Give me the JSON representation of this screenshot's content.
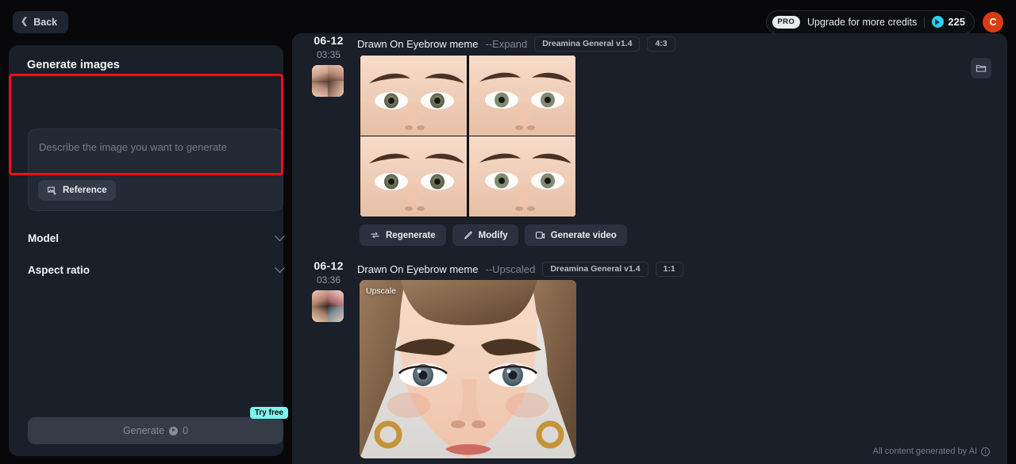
{
  "topbar": {
    "back_label": "Back",
    "back_icon": "chevron-left-icon",
    "pro_badge": "PRO",
    "upgrade_label": "Upgrade for more credits",
    "credit_icon": "credit-coin-icon",
    "credit_count": "225",
    "avatar_initial": "C",
    "avatar_color": "#d93c12",
    "credit_color": "#2fd0ee"
  },
  "left_panel": {
    "title": "Generate images",
    "prompt": {
      "value": "",
      "placeholder": "Describe the image you want to generate",
      "highlight_color": "#ff0a16",
      "reference_label": "Reference",
      "reference_icon": "add-image-icon"
    },
    "sections": [
      {
        "label": "Model",
        "icon": "chevron-down-icon"
      },
      {
        "label": "Aspect ratio",
        "icon": "chevron-down-icon"
      }
    ],
    "generate": {
      "label": "Generate",
      "cost_icon": "credit-coin-icon",
      "cost": "0",
      "try_free_label": "Try free",
      "try_free_color": "#7ef4ec"
    }
  },
  "content": {
    "folder_icon": "folder-icon",
    "footer_note": "All content generated by AI",
    "footer_icon": "info-icon",
    "items": [
      {
        "date": "06-12",
        "time": "03:35",
        "title": "Drawn On Eyebrow meme",
        "suffix": "--Expand",
        "model": "Dreamina General v1.4",
        "ratio": "4:3",
        "badge": "",
        "thumb_name": "generation-thumbnail",
        "actions": [
          {
            "label": "Regenerate",
            "icon": "regenerate-icon"
          },
          {
            "label": "Modify",
            "icon": "pencil-icon"
          },
          {
            "label": "Generate video",
            "icon": "video-icon"
          }
        ]
      },
      {
        "date": "06-12",
        "time": "03:36",
        "title": "Drawn On Eyebrow meme",
        "suffix": "--Upscaled",
        "model": "Dreamina General v1.4",
        "ratio": "1:1",
        "badge": "Upscale",
        "thumb_name": "generation-thumbnail",
        "actions": []
      }
    ]
  }
}
